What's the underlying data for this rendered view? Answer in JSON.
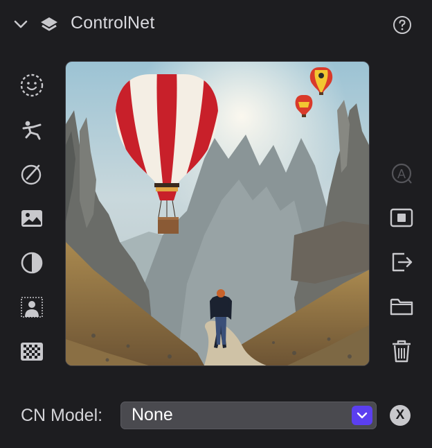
{
  "header": {
    "title": "ControlNet",
    "collapse_icon": "chevron-down-icon",
    "section_icon": "layers-icon",
    "help_icon": "question-circle-icon"
  },
  "left_tools": [
    {
      "icon": "face-icon"
    },
    {
      "icon": "pose-icon"
    },
    {
      "icon": "edit-circle-icon"
    },
    {
      "icon": "image-icon"
    },
    {
      "icon": "contrast-icon"
    },
    {
      "icon": "person-mask-icon"
    },
    {
      "icon": "checkerboard-icon"
    }
  ],
  "right_tools": [
    {
      "icon": "auto-annotate-icon",
      "disabled": true
    },
    {
      "icon": "fit-frame-icon"
    },
    {
      "icon": "export-icon"
    },
    {
      "icon": "folder-icon"
    },
    {
      "icon": "trash-icon"
    }
  ],
  "canvas": {
    "content": "hot-air-balloon-image"
  },
  "footer": {
    "label": "CN Model:",
    "select_value": "None",
    "clear_label": "X"
  },
  "colors": {
    "background": "#1d1d20",
    "accent": "#5b3ff0",
    "select_bg": "#4a4a4f"
  }
}
